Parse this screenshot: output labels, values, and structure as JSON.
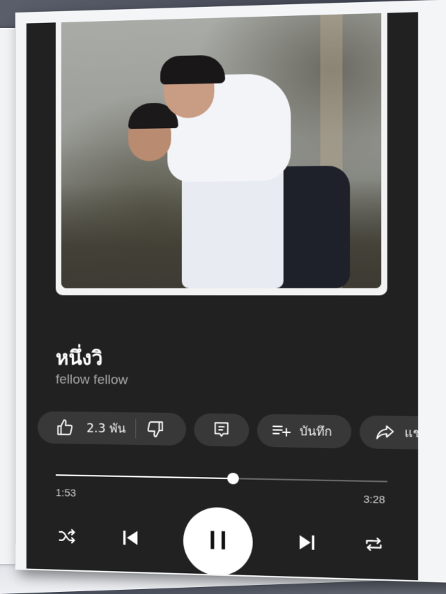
{
  "song": {
    "title": "หนึ่งวิ",
    "artist": "fellow fellow"
  },
  "actions": {
    "like_count": "2.3 พัน",
    "save_label": "บันทึก",
    "share_label": "แชร์"
  },
  "player": {
    "current_time": "1:53",
    "total_time": "3:28",
    "progress_fraction": 0.543,
    "state": "playing"
  },
  "icons": [
    "like-icon",
    "dislike-icon",
    "comment-icon",
    "playlist-add-icon",
    "share-icon",
    "shuffle-icon",
    "previous-icon",
    "pause-icon",
    "next-icon",
    "repeat-icon"
  ],
  "colors": {
    "background": "#212121",
    "pill": "#383838",
    "text": "#ffffff",
    "subtext": "#a7a7a7",
    "track": "#6a6a6a"
  }
}
